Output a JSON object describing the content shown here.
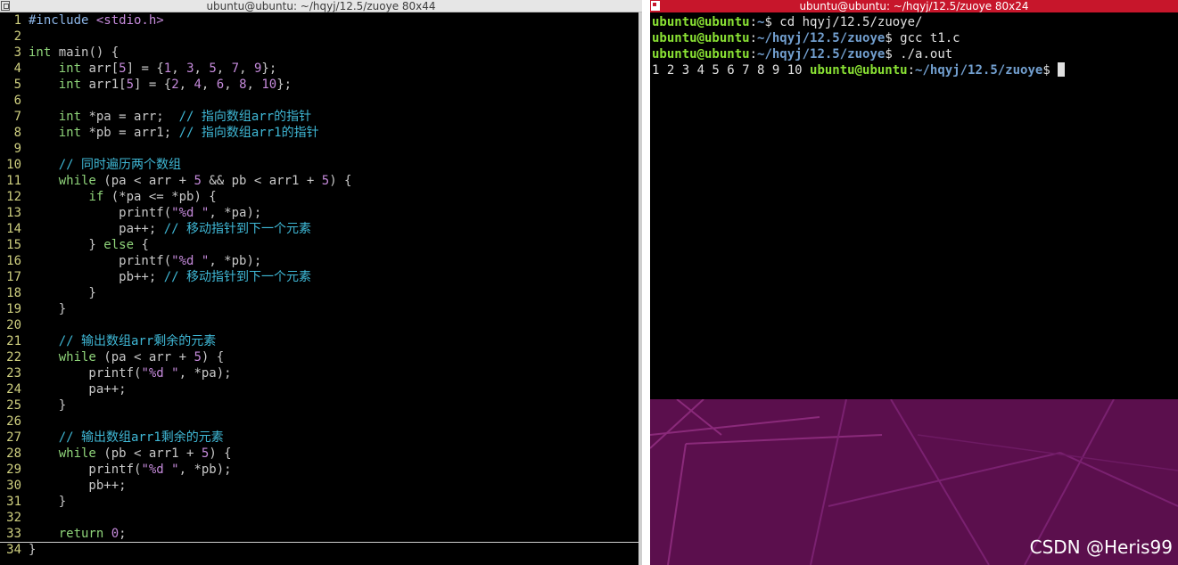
{
  "left_window": {
    "title": "ubuntu@ubuntu: ~/hqyj/12.5/zuoye 80x44",
    "lines": [
      {
        "n": "1",
        "segs": [
          [
            "pp",
            "#include "
          ],
          [
            "str",
            "<stdio.h>"
          ]
        ]
      },
      {
        "n": "2",
        "segs": []
      },
      {
        "n": "3",
        "segs": [
          [
            "ty",
            "int"
          ],
          [
            "code",
            " main() {"
          ]
        ]
      },
      {
        "n": "4",
        "segs": [
          [
            "code",
            "    "
          ],
          [
            "ty",
            "int"
          ],
          [
            "code",
            " arr["
          ],
          [
            "num",
            "5"
          ],
          [
            "code",
            "] = {"
          ],
          [
            "num",
            "1"
          ],
          [
            "code",
            ", "
          ],
          [
            "num",
            "3"
          ],
          [
            "code",
            ", "
          ],
          [
            "num",
            "5"
          ],
          [
            "code",
            ", "
          ],
          [
            "num",
            "7"
          ],
          [
            "code",
            ", "
          ],
          [
            "num",
            "9"
          ],
          [
            "code",
            "};"
          ]
        ]
      },
      {
        "n": "5",
        "segs": [
          [
            "code",
            "    "
          ],
          [
            "ty",
            "int"
          ],
          [
            "code",
            " arr1["
          ],
          [
            "num",
            "5"
          ],
          [
            "code",
            "] = {"
          ],
          [
            "num",
            "2"
          ],
          [
            "code",
            ", "
          ],
          [
            "num",
            "4"
          ],
          [
            "code",
            ", "
          ],
          [
            "num",
            "6"
          ],
          [
            "code",
            ", "
          ],
          [
            "num",
            "8"
          ],
          [
            "code",
            ", "
          ],
          [
            "num",
            "10"
          ],
          [
            "code",
            "};"
          ]
        ]
      },
      {
        "n": "6",
        "segs": []
      },
      {
        "n": "7",
        "segs": [
          [
            "code",
            "    "
          ],
          [
            "ty",
            "int"
          ],
          [
            "code",
            " *pa = arr;  "
          ],
          [
            "cm",
            "// 指向数组arr的指针"
          ]
        ]
      },
      {
        "n": "8",
        "segs": [
          [
            "code",
            "    "
          ],
          [
            "ty",
            "int"
          ],
          [
            "code",
            " *pb = arr1; "
          ],
          [
            "cm",
            "// 指向数组arr1的指针"
          ]
        ]
      },
      {
        "n": "9",
        "segs": []
      },
      {
        "n": "10",
        "segs": [
          [
            "code",
            "    "
          ],
          [
            "cm",
            "// 同时遍历两个数组"
          ]
        ]
      },
      {
        "n": "11",
        "segs": [
          [
            "code",
            "    "
          ],
          [
            "kw",
            "while"
          ],
          [
            "code",
            " (pa < arr + "
          ],
          [
            "num",
            "5"
          ],
          [
            "code",
            " && pb < arr1 + "
          ],
          [
            "num",
            "5"
          ],
          [
            "code",
            ") {"
          ]
        ]
      },
      {
        "n": "12",
        "segs": [
          [
            "code",
            "        "
          ],
          [
            "kw",
            "if"
          ],
          [
            "code",
            " (*pa <= *pb) {"
          ]
        ]
      },
      {
        "n": "13",
        "segs": [
          [
            "code",
            "            printf("
          ],
          [
            "str",
            "\"%d \""
          ],
          [
            "code",
            ", *pa);"
          ]
        ]
      },
      {
        "n": "14",
        "segs": [
          [
            "code",
            "            pa++; "
          ],
          [
            "cm",
            "// 移动指针到下一个元素"
          ]
        ]
      },
      {
        "n": "15",
        "segs": [
          [
            "code",
            "        } "
          ],
          [
            "kw",
            "else"
          ],
          [
            "code",
            " {"
          ]
        ]
      },
      {
        "n": "16",
        "segs": [
          [
            "code",
            "            printf("
          ],
          [
            "str",
            "\"%d \""
          ],
          [
            "code",
            ", *pb);"
          ]
        ]
      },
      {
        "n": "17",
        "segs": [
          [
            "code",
            "            pb++; "
          ],
          [
            "cm",
            "// 移动指针到下一个元素"
          ]
        ]
      },
      {
        "n": "18",
        "segs": [
          [
            "code",
            "        }"
          ]
        ]
      },
      {
        "n": "19",
        "segs": [
          [
            "code",
            "    }"
          ]
        ]
      },
      {
        "n": "20",
        "segs": []
      },
      {
        "n": "21",
        "segs": [
          [
            "code",
            "    "
          ],
          [
            "cm",
            "// 输出数组arr剩余的元素"
          ]
        ]
      },
      {
        "n": "22",
        "segs": [
          [
            "code",
            "    "
          ],
          [
            "kw",
            "while"
          ],
          [
            "code",
            " (pa < arr + "
          ],
          [
            "num",
            "5"
          ],
          [
            "code",
            ") {"
          ]
        ]
      },
      {
        "n": "23",
        "segs": [
          [
            "code",
            "        printf("
          ],
          [
            "str",
            "\"%d \""
          ],
          [
            "code",
            ", *pa);"
          ]
        ]
      },
      {
        "n": "24",
        "segs": [
          [
            "code",
            "        pa++;"
          ]
        ]
      },
      {
        "n": "25",
        "segs": [
          [
            "code",
            "    }"
          ]
        ]
      },
      {
        "n": "26",
        "segs": []
      },
      {
        "n": "27",
        "segs": [
          [
            "code",
            "    "
          ],
          [
            "cm",
            "// 输出数组arr1剩余的元素"
          ]
        ]
      },
      {
        "n": "28",
        "segs": [
          [
            "code",
            "    "
          ],
          [
            "kw",
            "while"
          ],
          [
            "code",
            " (pb < arr1 + "
          ],
          [
            "num",
            "5"
          ],
          [
            "code",
            ") {"
          ]
        ]
      },
      {
        "n": "29",
        "segs": [
          [
            "code",
            "        printf("
          ],
          [
            "str",
            "\"%d \""
          ],
          [
            "code",
            ", *pb);"
          ]
        ]
      },
      {
        "n": "30",
        "segs": [
          [
            "code",
            "        pb++;"
          ]
        ]
      },
      {
        "n": "31",
        "segs": [
          [
            "code",
            "    }"
          ]
        ]
      },
      {
        "n": "32",
        "segs": []
      },
      {
        "n": "33",
        "segs": [
          [
            "code",
            "    "
          ],
          [
            "kw",
            "return"
          ],
          [
            "code",
            " "
          ],
          [
            "num",
            "0"
          ],
          [
            "code",
            ";"
          ]
        ]
      },
      {
        "n": "34",
        "segs": [
          [
            "code",
            "}"
          ]
        ]
      }
    ]
  },
  "right_window": {
    "title": "ubuntu@ubuntu: ~/hqyj/12.5/zuoye 80x24",
    "lines": [
      {
        "user": "ubuntu@ubuntu",
        "path": "~",
        "cmd": "$ cd hqyj/12.5/zuoye/"
      },
      {
        "user": "ubuntu@ubuntu",
        "path": "~/hqyj/12.5/zuoye",
        "cmd": "$ gcc t1.c"
      },
      {
        "user": "ubuntu@ubuntu",
        "path": "~/hqyj/12.5/zuoye",
        "cmd": "$ ./a.out"
      }
    ],
    "output": "1 2 3 4 5 6 7 8 9 10 ",
    "last_prompt": {
      "user": "ubuntu@ubuntu",
      "path": "~/hqyj/12.5/zuoye",
      "cmd": "$ "
    }
  },
  "watermark": "CSDN @Heris99",
  "colors": {
    "ubuntu_red": "#c7162b",
    "desktop_purple": "#5b0f4d",
    "prompt_green": "#8ae234",
    "prompt_blue": "#729fcf"
  }
}
